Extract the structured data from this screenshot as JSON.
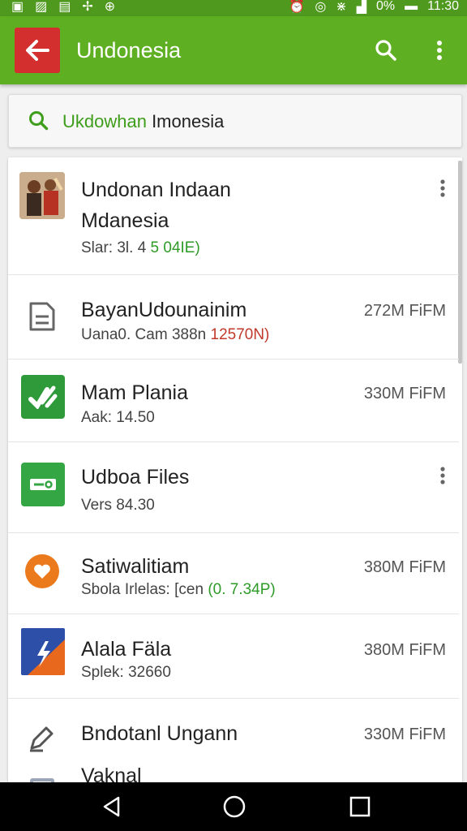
{
  "status": {
    "battery": "0%",
    "time": "11:30"
  },
  "toolbar": {
    "title": "Undonesia",
    "back_icon": "arrow-left-icon",
    "search_icon": "search-icon",
    "more_icon": "more-vert-icon",
    "color": "#5faf23"
  },
  "search": {
    "query_prefix": "Ukdowhan",
    "query_rest": " Imonesia"
  },
  "items": [
    {
      "title": "Undonan Indaan",
      "title2": "Mdanesia",
      "sub_a": "Slar: 3l. 4",
      "sub_b": "5 04IE)",
      "icon": "avatar-image"
    },
    {
      "title": "BayanUdounainim",
      "sub_a": "Uana0. Cam 388n",
      "sub_b": "12570N)",
      "size": "272M FiFM",
      "icon": "document-icon"
    },
    {
      "title": "Mam Plania",
      "sub_a": "Aak: 14.50",
      "size": "330M FiFM",
      "icon": "check-app-icon"
    },
    {
      "title": "Udboa Files",
      "sub_a": "Vers 84.30",
      "icon": "files-app-icon"
    },
    {
      "title": "Satiwalitiam",
      "sub_a": "Sbola Irlelas: [cen",
      "sub_b": "(0. 7.34P)",
      "size": "380M FiFM",
      "icon": "heart-app-icon"
    },
    {
      "title": "Alala Fäla",
      "sub_a": "Splek: 32660",
      "size": "380M FiFM",
      "icon": "bolt-app-icon"
    },
    {
      "title": "Bndotanl Ungann",
      "size": "330M FiFM",
      "icon": "edit-icon"
    },
    {
      "title": "Vaknal",
      "icon": "storage-icon"
    }
  ],
  "nav": {
    "back": "back-triangle-icon",
    "home": "home-circle-icon",
    "recents": "recents-square-icon"
  }
}
